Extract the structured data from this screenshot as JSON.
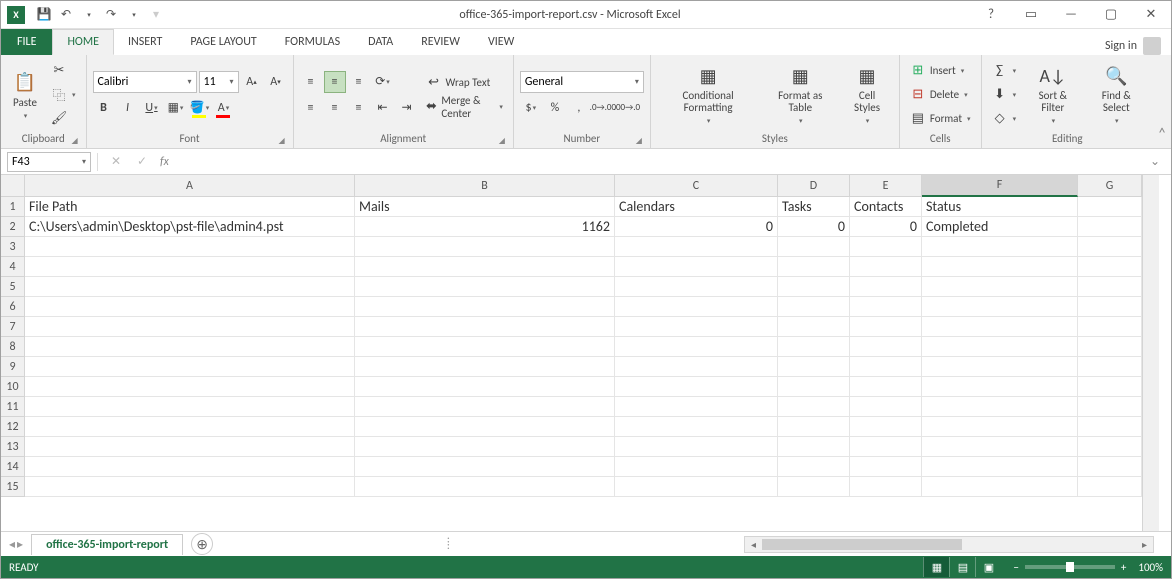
{
  "title": "office-365-import-report.csv - Microsoft Excel",
  "qat": {
    "save": "💾",
    "undo": "↶",
    "redo": "↷"
  },
  "tabs": {
    "file": "FILE",
    "home": "HOME",
    "insert": "INSERT",
    "pageLayout": "PAGE LAYOUT",
    "formulas": "FORMULAS",
    "data": "DATA",
    "review": "REVIEW",
    "view": "VIEW"
  },
  "signin": "Sign in",
  "ribbon": {
    "clipboard": {
      "paste": "Paste",
      "label": "Clipboard"
    },
    "font": {
      "name": "Calibri",
      "size": "11",
      "bold": "B",
      "italic": "I",
      "underline": "U",
      "label": "Font"
    },
    "alignment": {
      "wrap": "Wrap Text",
      "merge": "Merge & Center",
      "label": "Alignment"
    },
    "number": {
      "format": "General",
      "label": "Number"
    },
    "styles": {
      "cond": "Conditional Formatting",
      "fmtTable": "Format as Table",
      "cellStyles": "Cell Styles",
      "label": "Styles"
    },
    "cells": {
      "insert": "Insert",
      "delete": "Delete",
      "format": "Format",
      "label": "Cells"
    },
    "editing": {
      "sort": "Sort & Filter",
      "find": "Find & Select",
      "label": "Editing"
    }
  },
  "nameBox": "F43",
  "columns": [
    "A",
    "B",
    "C",
    "D",
    "E",
    "F",
    "G"
  ],
  "rows": [
    "1",
    "2",
    "3",
    "4",
    "5",
    "6",
    "7",
    "8",
    "9",
    "10",
    "11",
    "12",
    "13",
    "14",
    "15"
  ],
  "headers": {
    "A": "File Path",
    "B": "Mails",
    "C": "Calendars",
    "D": "Tasks",
    "E": "Contacts",
    "F": "Status"
  },
  "dataRow": {
    "A": "C:\\Users\\admin\\Desktop\\pst-file\\admin4.pst",
    "B": "1162",
    "C": "0",
    "D": "0",
    "E": "0",
    "F": "Completed"
  },
  "sheetName": "office-365-import-report",
  "status": {
    "ready": "READY",
    "zoom": "100%"
  }
}
